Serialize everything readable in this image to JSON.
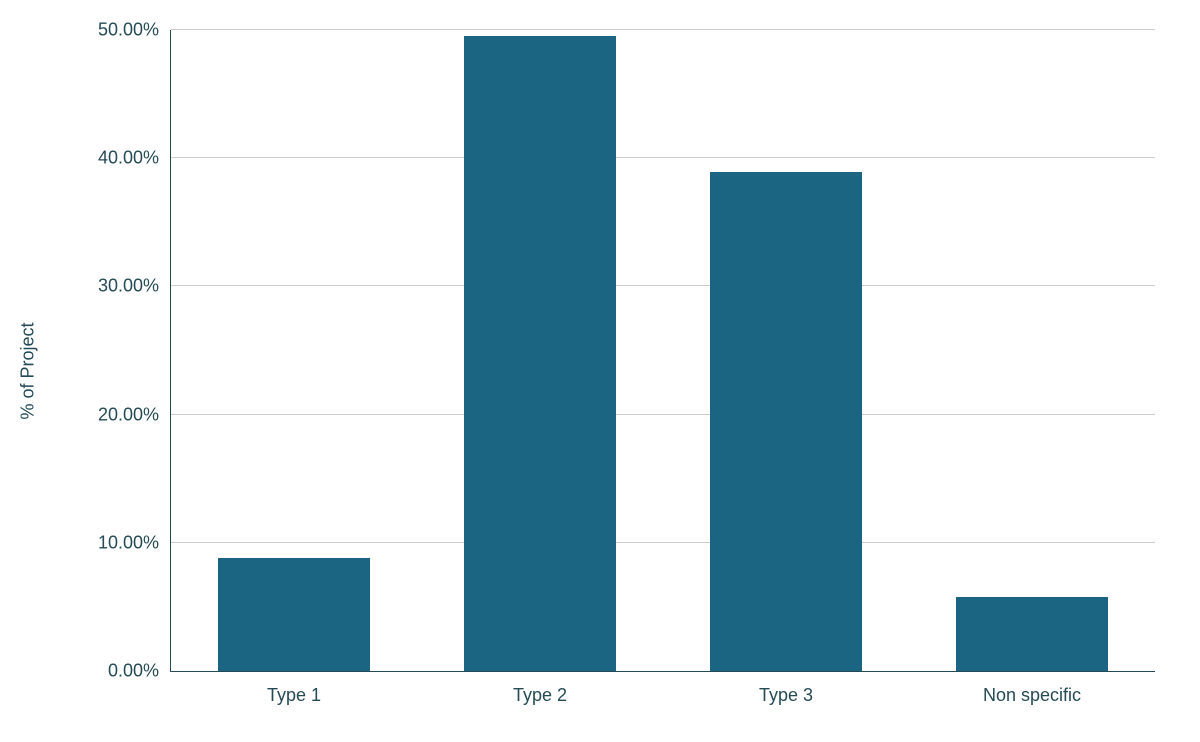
{
  "chart_data": {
    "type": "bar",
    "categories": [
      "Type 1",
      "Type 2",
      "Type 3",
      "Non specific"
    ],
    "values": [
      8.8,
      49.5,
      38.9,
      5.8
    ],
    "title": "",
    "xlabel": "",
    "ylabel": "% of Project",
    "ylim": [
      0,
      50
    ],
    "y_ticks": [
      0,
      10,
      20,
      30,
      40,
      50
    ],
    "y_tick_labels": [
      "0.00%",
      "10.00%",
      "20.00%",
      "30.00%",
      "40.00%",
      "50.00%"
    ],
    "bar_color": "#1b6583",
    "text_color": "#244b55"
  }
}
